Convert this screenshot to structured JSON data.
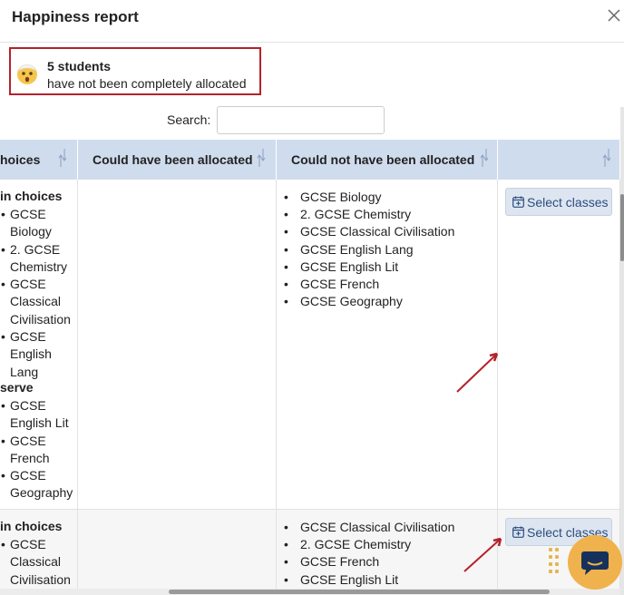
{
  "dialog": {
    "title": "Happiness report"
  },
  "notice": {
    "count_text": "5 students",
    "message": "have not been completely allocated"
  },
  "search": {
    "label": "Search:",
    "value": "",
    "placeholder": ""
  },
  "table": {
    "headers": [
      "hoices",
      "Could have been allocated",
      "Could not have been allocated",
      ""
    ],
    "rows": [
      {
        "col1_group1": "in choices",
        "col1_items1": [
          "GCSE Biology",
          "2. GCSE Chemistry",
          "GCSE Classical Civilisation",
          "GCSE English Lang"
        ],
        "col1_group2": "serve",
        "col1_items2": [
          "GCSE English Lit",
          "GCSE French",
          "GCSE Geography"
        ],
        "could_not": [
          "GCSE Biology",
          "2. GCSE Chemistry",
          "GCSE Classical Civilisation",
          "GCSE English Lang",
          "GCSE English Lit",
          "GCSE French",
          "GCSE Geography"
        ],
        "action_label": "Select classes"
      },
      {
        "col1_group1": "in choices",
        "col1_items1": [
          "GCSE Classical Civilisation"
        ],
        "could_not": [
          "GCSE Classical Civilisation",
          "2. GCSE Chemistry",
          "GCSE French",
          "GCSE English Lit"
        ],
        "action_label": "Select classes"
      }
    ]
  },
  "colors": {
    "header_bg": "#cfdcee",
    "notice_border": "#b4222b",
    "button_bg": "#dde5f0",
    "chat_bubble": "#f0b24c",
    "annotation_arrow": "#b4222b"
  }
}
